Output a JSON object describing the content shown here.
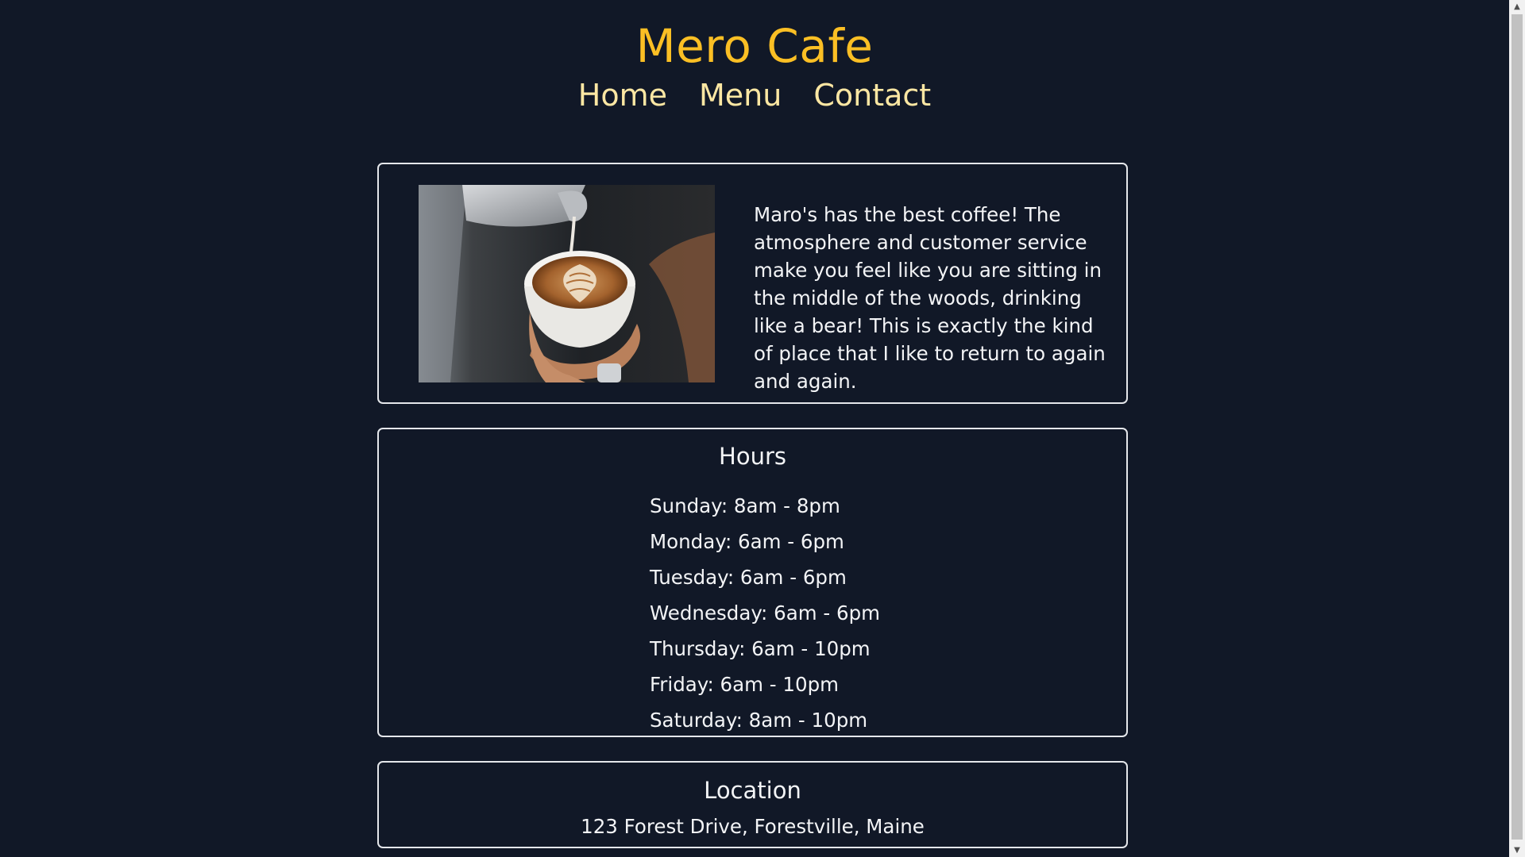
{
  "header": {
    "title": "Mero Cafe",
    "nav": [
      {
        "label": "Home"
      },
      {
        "label": "Menu"
      },
      {
        "label": "Contact"
      }
    ]
  },
  "about": {
    "text": "Maro's has the best coffee! The atmosphere and customer service make you feel like you are sitting in the middle of the woods, drinking like a bear! This is exactly the kind of place that I like to return to again and again."
  },
  "hours": {
    "title": "Hours",
    "days": [
      "Sunday: 8am - 8pm",
      "Monday: 6am - 6pm",
      "Tuesday: 6am - 6pm",
      "Wednesday: 6am - 6pm",
      "Thursday: 6am - 10pm",
      "Friday: 6am - 10pm",
      "Saturday: 8am - 10pm"
    ]
  },
  "location": {
    "title": "Location",
    "address": "123 Forest Drive, Forestville, Maine"
  },
  "colors": {
    "background": "#111827",
    "title_accent": "#fbbf24",
    "nav_text": "#fde7a3",
    "border": "#e5e7eb"
  },
  "icons": {
    "scroll_up": "up-arrow-icon",
    "scroll_down": "down-arrow-icon"
  }
}
